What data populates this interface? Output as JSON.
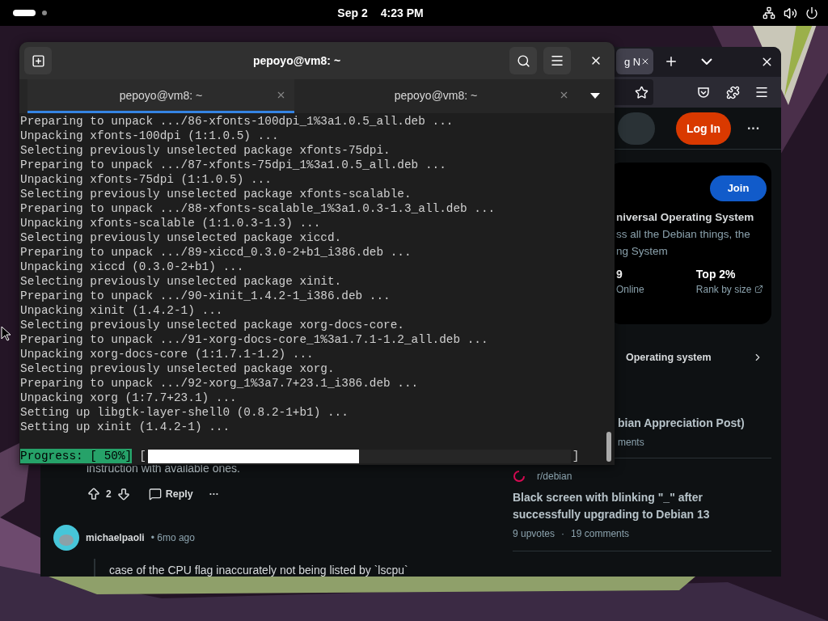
{
  "top_bar": {
    "date": "Sep 2",
    "time": "4:23 PM"
  },
  "browser": {
    "tab": {
      "title": "g N"
    },
    "header": {
      "login": "Log In",
      "more": "···"
    },
    "community_card": {
      "join": "Join",
      "title": "niversal Operating System",
      "description_lines": [
        "ss all the Debian things, the",
        "ng System"
      ],
      "stats": [
        {
          "value": "9",
          "label": "Online",
          "link": false
        },
        {
          "value": "Top 2%",
          "label": "Rank by size",
          "link": true
        }
      ]
    },
    "topic": {
      "label": "Operating system"
    },
    "posts": [
      {
        "kind": "partial",
        "title": "bian Appreciation Post)",
        "meta": "ments"
      },
      {
        "kind": "full",
        "community": "r/debian",
        "title": "Black screen with blinking \"_\" after successfully upgrading to Debian 13",
        "upvotes": "9 upvotes",
        "separator": "·",
        "comments": "19 comments"
      }
    ],
    "comment": {
      "trailing_text": "instruction with available ones.",
      "votes": "2",
      "reply": "Reply",
      "more": "···",
      "reply_author": "michaelpaoli",
      "reply_age": "• 6mo ago",
      "reply_text": "case of the CPU flag inaccurately not being listed by `lscpu`"
    }
  },
  "terminal": {
    "title": "pepoyo@vm8: ~",
    "tabs": [
      {
        "label": "pepoyo@vm8: ~",
        "selected": true
      },
      {
        "label": "pepoyo@vm8: ~",
        "selected": false
      }
    ],
    "lines": [
      "Preparing to unpack .../86-xfonts-100dpi_1%3a1.0.5_all.deb ...",
      "Unpacking xfonts-100dpi (1:1.0.5) ...",
      "Selecting previously unselected package xfonts-75dpi.",
      "Preparing to unpack .../87-xfonts-75dpi_1%3a1.0.5_all.deb ...",
      "Unpacking xfonts-75dpi (1:1.0.5) ...",
      "Selecting previously unselected package xfonts-scalable.",
      "Preparing to unpack .../88-xfonts-scalable_1%3a1.0.3-1.3_all.deb ...",
      "Unpacking xfonts-scalable (1:1.0.3-1.3) ...",
      "Selecting previously unselected package xiccd.",
      "Preparing to unpack .../89-xiccd_0.3.0-2+b1_i386.deb ...",
      "Unpacking xiccd (0.3.0-2+b1) ...",
      "Selecting previously unselected package xinit.",
      "Preparing to unpack .../90-xinit_1.4.2-1_i386.deb ...",
      "Unpacking xinit (1.4.2-1) ...",
      "Selecting previously unselected package xorg-docs-core.",
      "Preparing to unpack .../91-xorg-docs-core_1%3a1.7.1-1.2_all.deb ...",
      "Unpacking xorg-docs-core (1:1.7.1-1.2) ...",
      "Selecting previously unselected package xorg.",
      "Preparing to unpack .../92-xorg_1%3a7.7+23.1_i386.deb ...",
      "Unpacking xorg (1:7.7+23.1) ...",
      "Setting up libgtk-layer-shell0 (0.8.2-1+b1) ...",
      "Setting up xinit (1.4.2-1) ..."
    ],
    "progress": {
      "label": "Progress: [ 50%]",
      "open": "[",
      "close": "]",
      "level": 0.5
    }
  }
}
